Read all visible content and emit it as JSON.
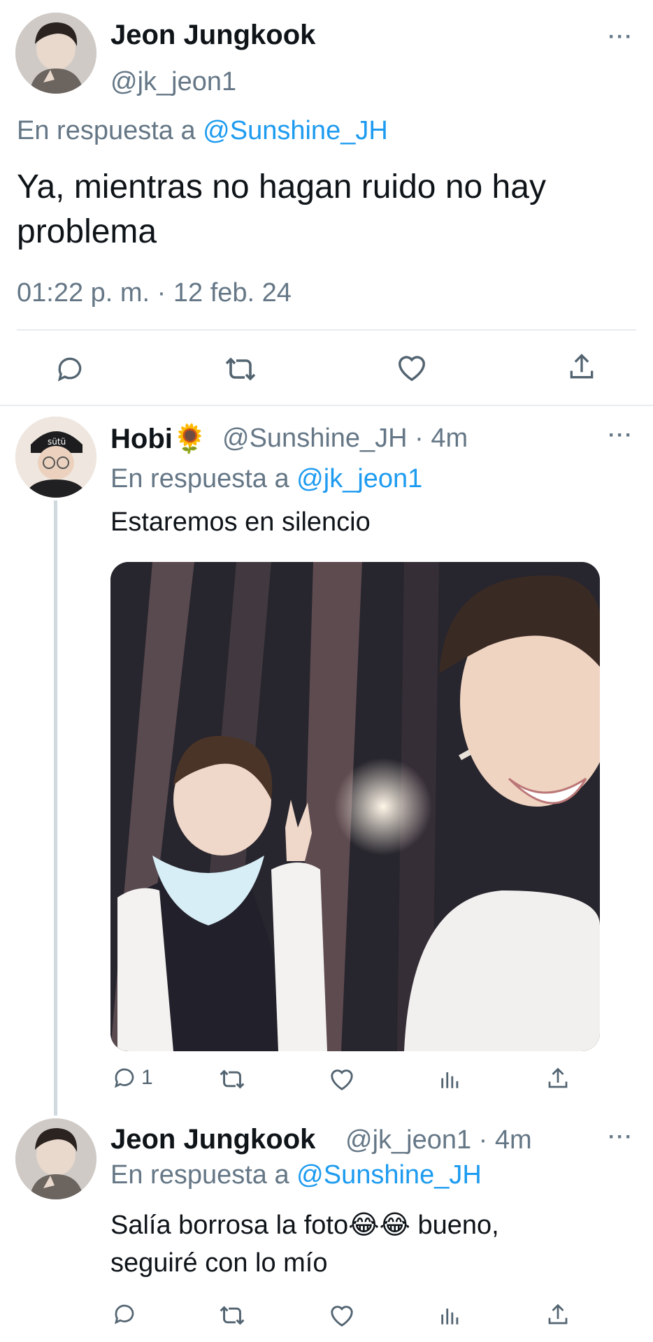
{
  "main_tweet": {
    "display_name": "Jeon Jungkook",
    "handle": "@jk_jeon1",
    "reply_prefix": "En respuesta a",
    "reply_to": "@Sunshine_JH",
    "text": "Ya, mientras no hagan ruido no hay problema",
    "timestamp": "01:22 p. m. · 12 feb. 24",
    "menu_icon": "more-dots-icon",
    "actions": [
      "reply-icon",
      "retweet-icon",
      "like-icon",
      "share-icon"
    ]
  },
  "reply_1": {
    "display_name": "Hobi🌻",
    "handle": "@Sunshine_JH · 4m",
    "reply_prefix": "En respuesta a",
    "reply_to": "@jk_jeon1",
    "text": "Estaremos en silencio",
    "reply_count": "1",
    "actions": [
      "reply-icon",
      "retweet-icon",
      "like-icon",
      "stats-icon",
      "share-icon"
    ]
  },
  "reply_2": {
    "display_name": "Jeon Jungkook",
    "handle": "@jk_jeon1 · 4m",
    "reply_prefix": "En respuesta a",
    "reply_to": "@Sunshine_JH",
    "text_line1": "Salía borrosa la foto😂😂 bueno,",
    "text_line2": "seguiré con lo mío",
    "actions": [
      "reply-icon",
      "retweet-icon",
      "like-icon",
      "stats-icon",
      "share-icon"
    ]
  },
  "colors": {
    "link": "#1d9bf0",
    "muted": "#657786",
    "divider": "#e6ecf0"
  }
}
